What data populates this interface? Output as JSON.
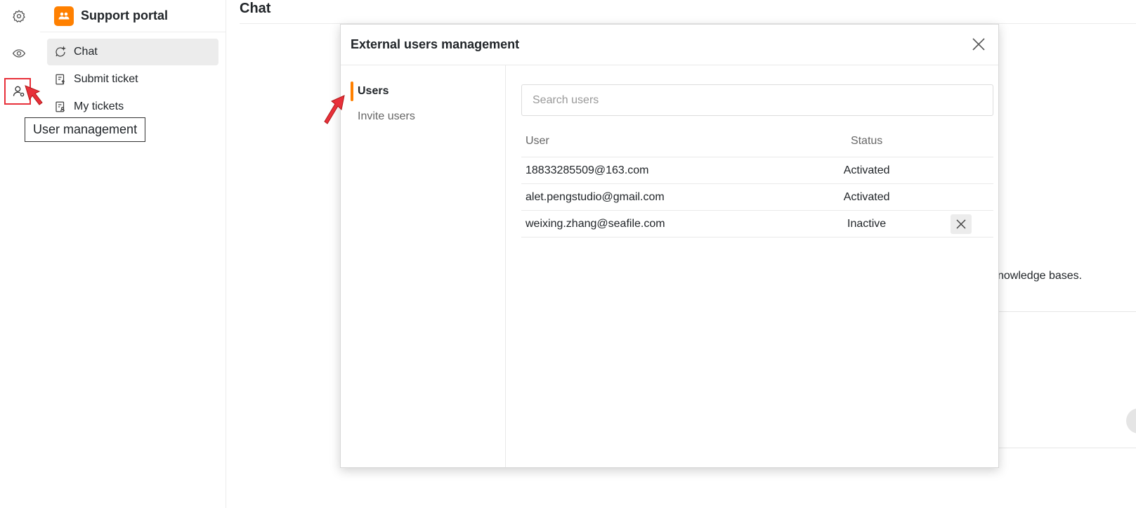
{
  "rail": {
    "items": [
      {
        "name": "settings",
        "icon": "gear-icon"
      },
      {
        "name": "preview",
        "icon": "eye-icon"
      },
      {
        "name": "user-management",
        "icon": "user-icon"
      }
    ],
    "tooltip": "User management"
  },
  "sidebar": {
    "title": "Support portal",
    "logo_icon": "users-logo-icon",
    "items": [
      {
        "label": "Chat",
        "icon": "chat-icon",
        "active": true
      },
      {
        "label": "Submit ticket",
        "icon": "ticket-icon",
        "active": false
      },
      {
        "label": "My tickets",
        "icon": "my-tickets-icon",
        "active": false
      }
    ]
  },
  "main": {
    "title": "Chat",
    "background_text": "nowledge bases."
  },
  "modal": {
    "title": "External users management",
    "tabs": [
      {
        "label": "Users",
        "active": true
      },
      {
        "label": "Invite users",
        "active": false
      }
    ],
    "search_placeholder": "Search users",
    "table": {
      "columns": [
        "User",
        "Status"
      ],
      "rows": [
        {
          "user": "18833285509@163.com",
          "status": "Activated"
        },
        {
          "user": "alet.pengstudio@gmail.com",
          "status": "Activated"
        },
        {
          "user": "weixing.zhang@seafile.com",
          "status": "Inactive"
        }
      ]
    }
  },
  "colors": {
    "accent": "#ff8000",
    "annotation": "#e8303a",
    "active_bg": "#ececec"
  }
}
